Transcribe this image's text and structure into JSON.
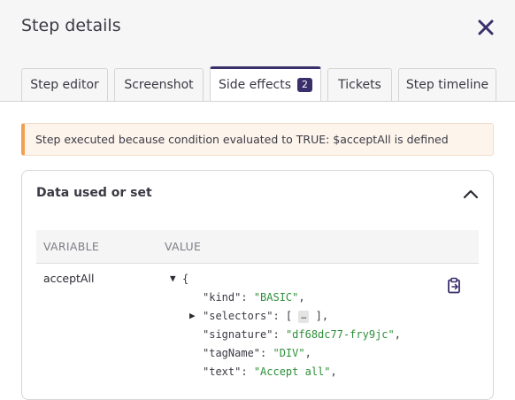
{
  "modal": {
    "title": "Step details"
  },
  "tabs": [
    {
      "label": "Step editor"
    },
    {
      "label": "Screenshot"
    },
    {
      "label": "Side effects",
      "badge": "2",
      "active": true
    },
    {
      "label": "Tickets"
    },
    {
      "label": "Step timeline"
    }
  ],
  "alert": {
    "text": "Step executed because condition evaluated to TRUE: $acceptAll is defined"
  },
  "section": {
    "title": "Data used or set",
    "columns": {
      "variable": "VARIABLE",
      "value": "VALUE"
    },
    "rows": [
      {
        "variable": "acceptAll",
        "json": {
          "open": "{",
          "entries": [
            {
              "key": "\"kind\"",
              "value": "\"BASIC\""
            },
            {
              "key": "\"selectors\"",
              "collapsed": "…"
            },
            {
              "key": "\"signature\"",
              "value": "\"df68dc77-fry9jc\""
            },
            {
              "key": "\"tagName\"",
              "value": "\"DIV\""
            },
            {
              "key": "\"text\"",
              "value": "\"Accept all\""
            }
          ]
        }
      }
    ]
  },
  "icons": {
    "close": "close-icon",
    "collapse": "chevron-up-icon",
    "copy": "clipboard-icon",
    "expanded": "triangle-down-icon",
    "collapsed": "triangle-right-icon"
  },
  "colors": {
    "accent": "#3b2f6b",
    "alert_border": "#f0a050",
    "alert_bg": "#fdf4ec",
    "json_string": "#2f8f3a"
  }
}
